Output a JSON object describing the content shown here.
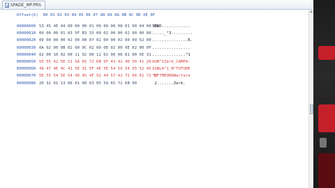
{
  "tab": {
    "title": "SPADE_MP.PRS"
  },
  "hex_header": "Offset(h)  00 01 02 03 04 05 06 07 08 09 0A 0B 0C 0D 0E 0F",
  "rows": [
    {
      "addr": "00000000",
      "hex": "53 45 4E 44 00 00 00 01 00 00 00 00 01 00 04 00 00",
      "text": "SEND............",
      "style": "normal"
    },
    {
      "addr": "00000010",
      "hex": "00 00 00 01 03 5F B3 33 00 02 00 00 02 00 00 00",
      "text": "....._³3.........",
      "style": "normal"
    },
    {
      "addr": "00000020",
      "hex": "00 00 00 00 02 00 00 07 02 00 00 02 00 09 52 00",
      "text": "...............R.",
      "style": "normal"
    },
    {
      "addr": "00000030",
      "hex": "0A 02 00 0B 02 00 0C 02 00 0D 02 00 0E 02 00 0F",
      "text": "................",
      "style": "normal"
    },
    {
      "addr": "00000040",
      "hex": "02 00 10 02 00 11 02 00 12 02 00 06 81 00 5E 31",
      "text": "..............^1",
      "style": "normal"
    },
    {
      "addr": "00000050",
      "hex": "55 55 42 5E 51 5A 65 72 6B 5F 43 41 4D 50 41 20",
      "text": "UUB^1Zerk_CAMPA-",
      "style": "red"
    },
    {
      "addr": "00000060",
      "hex": "49 47 4E 4C 41 5E 31 5F 4E 5E 54 55 54 55 52 45",
      "text": "IGNLA^1_N^TUTURE",
      "style": "red"
    },
    {
      "addr": "00000070",
      "hex": "5E 55 54 5E 54 4D 45 4F 52 44 57 41 72 66 61 72 65",
      "text": "^U^TMEORDWarfare",
      "style": "mixed"
    },
    {
      "addr": "00000080",
      "hex": "20 32 01 13 06 01 00 03 05 5A 65 72 6B 00",
      "text": " 2.......Zerk.",
      "style": "normal"
    }
  ],
  "colors": {
    "offset_blue": "#2a55b0",
    "hex_text": "#3a4a6a",
    "highlight_red": "#d23a3a"
  }
}
